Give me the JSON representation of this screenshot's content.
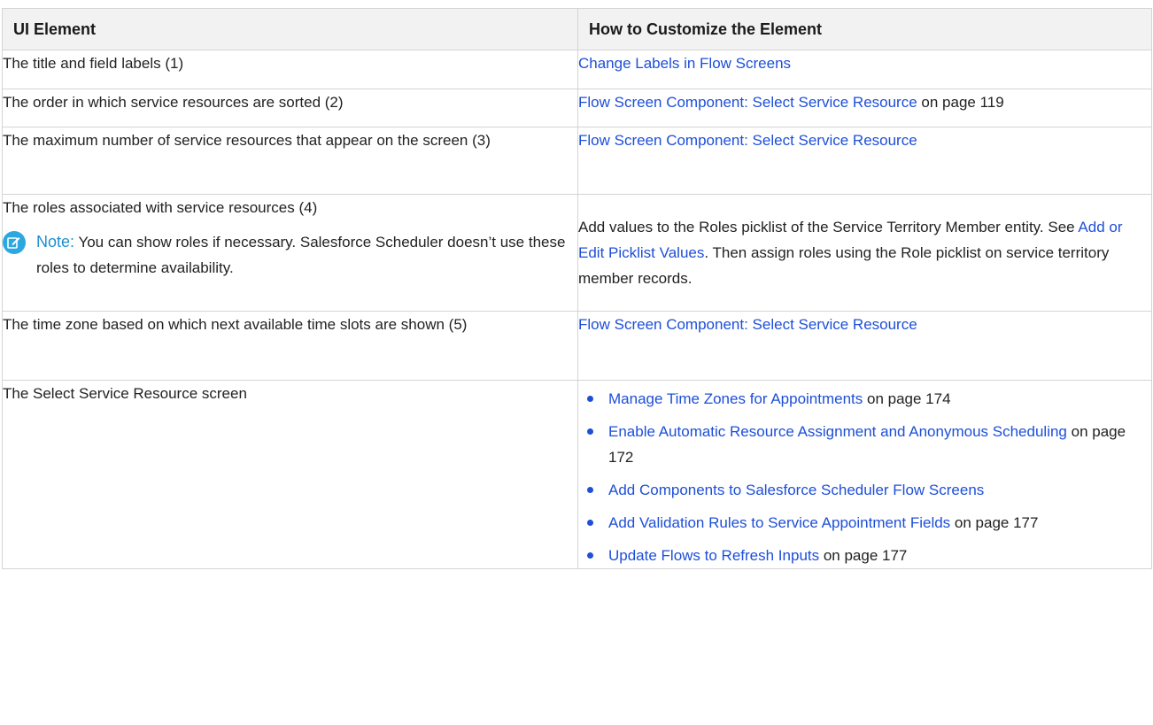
{
  "table": {
    "headers": [
      "UI Element",
      "How to Customize the Element"
    ],
    "rows": [
      {
        "element": "The title and field labels (1)",
        "links": [
          {
            "text": "Change Labels in Flow Screens",
            "suffix": ""
          }
        ]
      },
      {
        "element": "The order in which service resources are sorted (2)",
        "links": [
          {
            "text": "Flow Screen Component: Select Service Resource",
            "suffix": " on page 119"
          }
        ]
      },
      {
        "element": "The maximum number of service resources that appear on the screen (3)",
        "links": [
          {
            "text": "Flow Screen Component: Select Service Resource",
            "suffix": ""
          }
        ]
      },
      {
        "element": "The roles associated with service resources (4)",
        "note": {
          "icon": "note-edit-icon",
          "label": "Note:",
          "text": "You can show roles if necessary. Salesforce Scheduler doesn’t use these roles to determine availability."
        },
        "how": {
          "before": "Add values to the Roles picklist of the Service Territory Member entity. See ",
          "link": "Add or Edit Picklist Values",
          "after": ". Then assign roles using the Role picklist on service territory member records."
        }
      },
      {
        "element": "The time zone based on which next available time slots are shown (5)",
        "links": [
          {
            "text": "Flow Screen Component: Select Service Resource",
            "suffix": ""
          }
        ]
      },
      {
        "element": "The Select Service Resource screen",
        "bullets": [
          {
            "text": "Manage Time Zones for Appointments",
            "suffix": " on page 174"
          },
          {
            "text": "Enable Automatic Resource Assignment and Anonymous Scheduling",
            "suffix": " on page 172"
          },
          {
            "text": "Add Components to Salesforce Scheduler Flow Screens",
            "suffix": ""
          },
          {
            "text": "Add Validation Rules to Service Appointment Fields",
            "suffix": " on page 177"
          },
          {
            "text": "Update Flows to Refresh Inputs",
            "suffix": " on page 177"
          }
        ]
      }
    ]
  },
  "colors": {
    "link": "#1d4fd8",
    "note_accent": "#2ca8e0",
    "header_bg": "#f2f2f2",
    "border": "#d4d4d4"
  }
}
